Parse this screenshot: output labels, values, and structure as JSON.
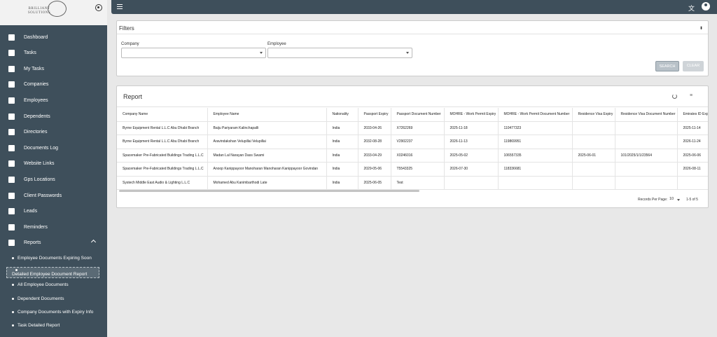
{
  "brand": {
    "logo_line1": "BRILLIANT",
    "logo_line2": "SOLUTIONS"
  },
  "sidebar": {
    "items": [
      {
        "label": "Dashboard",
        "icon": "dashboard-icon"
      },
      {
        "label": "Tasks",
        "icon": "tasks-icon"
      },
      {
        "label": "My Tasks",
        "icon": "list-icon"
      },
      {
        "label": "Companies",
        "icon": "building-icon"
      },
      {
        "label": "Employees",
        "icon": "people-icon"
      },
      {
        "label": "Dependents",
        "icon": "group-icon"
      },
      {
        "label": "Directories",
        "icon": "folder-icon"
      },
      {
        "label": "Documents Log",
        "icon": "eye-icon"
      },
      {
        "label": "Website Links",
        "icon": "link-icon"
      },
      {
        "label": "Gps Locations",
        "icon": "location-icon"
      },
      {
        "label": "Client Passwords",
        "icon": "key-icon"
      },
      {
        "label": "Leads",
        "icon": "leads-icon"
      },
      {
        "label": "Reminders",
        "icon": "calendar-icon"
      },
      {
        "label": "Reports",
        "icon": "reports-icon"
      }
    ],
    "report_subitems": [
      {
        "label": "Employee Documents Expiring Soon"
      },
      {
        "label": "Detailed Employee Document Report"
      },
      {
        "label": "All Employee Documents"
      },
      {
        "label": "Dependent Documents"
      },
      {
        "label": "Company Documents with Expiry Info"
      },
      {
        "label": "Task Detailed Report"
      }
    ]
  },
  "topbar": {
    "translate_icon": "translate-icon",
    "user_icon": "account-circle-icon"
  },
  "filters": {
    "title": "Filters",
    "company_label": "Company",
    "employee_label": "Employee",
    "company_value": "",
    "employee_value": "",
    "search_label": "SEARCH",
    "clear_label": "CLEAR"
  },
  "report": {
    "title": "Report",
    "columns": [
      "Company Name",
      "Employee Name",
      "Nationality",
      "Passport Expiry",
      "Passport Document Number",
      "MOHRE - Work Permit Expiry",
      "MOHRE - Work Permit Document Number",
      "Residence Visa Expiry",
      "Residence Visa Document Number",
      "Emirates ID Expiry"
    ],
    "rows": [
      [
        "Byrne Equipment Rental L.L.C Abu Dhabi Branch",
        "Baiju Pariyaram Kalinchapalli",
        "India",
        "2033-04-26",
        "X7262269",
        "2025-11-18",
        "110477323",
        "",
        "",
        "2025-11-14"
      ],
      [
        "Byrne Equipment Rental L.L.C Abu Dhabi Branch",
        "Aravindakshan Velupillai Velupillai",
        "India",
        "2032-08-28",
        "V2902237",
        "2026-11-13",
        "119869951",
        "",
        "",
        "2026-11-24"
      ],
      [
        "Spacemaker Pre-Fabricated Buildings Trading L.L.C",
        "Madan Lal Narayan Dass Swami",
        "India",
        "2033-04-29",
        "X0246016",
        "2025-05-02",
        "106557335",
        "2025-06-01",
        "101/2025/1/1/23564",
        "2025-06-06"
      ],
      [
        "Spacemaker Pre-Fabricated Buildings Trading L.L.C",
        "Anoop Kanippayoor Manoharan Manoharan Kanippayoor Govindan",
        "India",
        "2029-05-06",
        "T5543325",
        "2026-07-30",
        "118336681",
        "",
        "",
        "2026-08-11"
      ],
      [
        "Systech Middle East Audio & Lighting L.L.C",
        "Mohamed Abu Kanimbarthodi Late",
        "India",
        "2025-06-05",
        "Test",
        "",
        "",
        "",
        "",
        ""
      ]
    ],
    "records_per_page_label": "Records Per Page:",
    "records_per_page": "10",
    "range": "1-5 of 5"
  }
}
